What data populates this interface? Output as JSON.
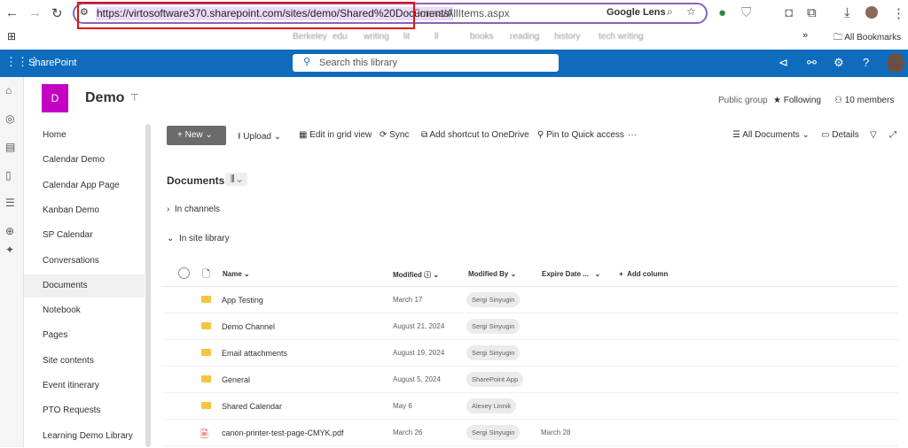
{
  "browser": {
    "url_highlighted": "https://virtosoftware370.sharepoint.com/sites/demo/Shared%20Documents/",
    "url_rest": "Forms/AllItems.aspx",
    "google_lens": "Google Lens",
    "bookmark_folders": [
      "Berkeley",
      "edu",
      "writing",
      "lit",
      "ll",
      "books",
      "reading",
      "history",
      "tech writing"
    ],
    "all_bookmarks": "All Bookmarks"
  },
  "sp": {
    "app": "SharePoint",
    "search_placeholder": "Search this library"
  },
  "site": {
    "logo_letter": "D",
    "title": "Demo",
    "visibility": "Public group",
    "following": "Following",
    "members": "10 members"
  },
  "nav": [
    "Home",
    "Calendar Demo",
    "Calendar App Page",
    "Kanban Demo",
    "SP Calendar",
    "Conversations",
    "Documents",
    "Notebook",
    "Pages",
    "Site contents",
    "Event itinerary",
    "PTO Requests",
    "Learning Demo Library"
  ],
  "commands": {
    "new": "New",
    "upload": "Upload",
    "grid": "Edit in grid view",
    "sync": "Sync",
    "shortcut": "Add shortcut to OneDrive",
    "pin": "Pin to Quick access",
    "more": "···",
    "view": "All Documents",
    "details": "Details"
  },
  "library": {
    "title": "Documents",
    "in_channels": "In channels",
    "in_site_library": "In site library"
  },
  "columns": {
    "name": "Name",
    "modified": "Modified",
    "modified_by": "Modified By",
    "expire": "Expire Date ...",
    "add": "Add column"
  },
  "rows": [
    {
      "name": "App Testing",
      "type": "folder",
      "modified": "March 17",
      "by": "Sergi Sinyugin",
      "expire": ""
    },
    {
      "name": "Demo Channel",
      "type": "folder",
      "modified": "August 21, 2024",
      "by": "Sergi Sinyugin",
      "expire": ""
    },
    {
      "name": "Email attachments",
      "type": "folder",
      "modified": "August 19, 2024",
      "by": "Sergi Sinyugin",
      "expire": ""
    },
    {
      "name": "General",
      "type": "folder",
      "modified": "August 5, 2024",
      "by": "SharePoint App",
      "expire": ""
    },
    {
      "name": "Shared Calendar",
      "type": "folder",
      "modified": "May 6",
      "by": "Alexey Linnik",
      "expire": ""
    },
    {
      "name": "canon-printer-test-page-CMYK.pdf",
      "type": "pdf",
      "modified": "March 26",
      "by": "Sergi Sinyugin",
      "expire": "March 28"
    }
  ]
}
